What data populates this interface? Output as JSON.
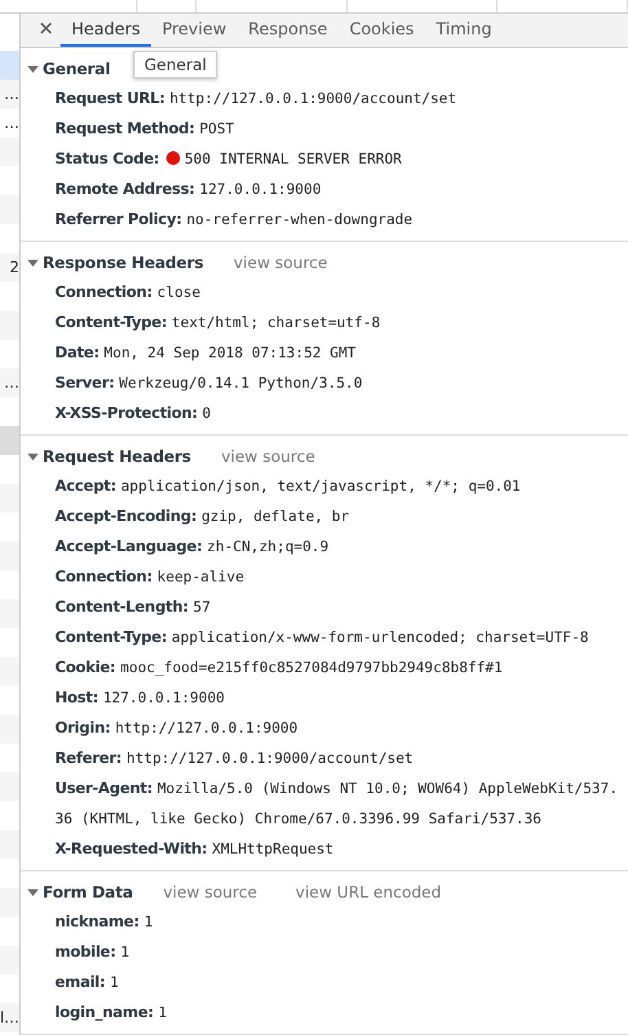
{
  "request_list": {
    "rows": [
      {
        "selected": true,
        "hovered": false
      },
      {
        "text": "…",
        "selected": false,
        "hovered": false
      },
      {
        "text": "…",
        "selected": false,
        "hovered": false
      },
      {
        "selected": false,
        "hovered": false
      },
      {
        "selected": false,
        "hovered": false
      },
      {
        "selected": false,
        "hovered": false
      },
      {
        "selected": false,
        "hovered": false
      },
      {
        "text": "2",
        "selected": false,
        "hovered": false
      },
      {
        "selected": false,
        "hovered": false
      },
      {
        "selected": false,
        "hovered": false
      },
      {
        "selected": false,
        "hovered": false
      },
      {
        "text": "…",
        "selected": false,
        "hovered": false
      },
      {
        "selected": false,
        "hovered": false
      },
      {
        "selected": false,
        "hovered": true
      },
      {
        "selected": false,
        "hovered": false
      },
      {
        "selected": false,
        "hovered": false
      },
      {
        "selected": false,
        "hovered": false
      },
      {
        "selected": false,
        "hovered": false
      },
      {
        "selected": false,
        "hovered": false
      },
      {
        "selected": false,
        "hovered": false
      },
      {
        "selected": false,
        "hovered": false
      },
      {
        "selected": false,
        "hovered": false
      },
      {
        "selected": false,
        "hovered": false
      },
      {
        "selected": false,
        "hovered": false
      },
      {
        "selected": false,
        "hovered": false
      },
      {
        "selected": false,
        "hovered": false
      },
      {
        "selected": false,
        "hovered": false
      },
      {
        "selected": false,
        "hovered": false
      },
      {
        "selected": false,
        "hovered": false
      },
      {
        "selected": false,
        "hovered": false
      },
      {
        "selected": false,
        "hovered": false
      },
      {
        "selected": false,
        "hovered": false
      },
      {
        "selected": false,
        "hovered": false
      },
      {
        "text": "l…",
        "selected": false,
        "hovered": false
      }
    ]
  },
  "tabs": [
    {
      "label": "Headers",
      "selected": true
    },
    {
      "label": "Preview",
      "selected": false
    },
    {
      "label": "Response",
      "selected": false
    },
    {
      "label": "Cookies",
      "selected": false
    },
    {
      "label": "Timing",
      "selected": false
    }
  ],
  "tooltip": "General",
  "sections": [
    {
      "title": "General",
      "expanded": true,
      "rows": [
        {
          "name": "Request URL:",
          "value": "http://127.0.0.1:9000/account/set"
        },
        {
          "name": "Request Method:",
          "value": "POST"
        },
        {
          "name": "Status Code:",
          "value": "500 INTERNAL SERVER ERROR",
          "color": "#e0120c"
        },
        {
          "name": "Remote Address:",
          "value": "127.0.0.1:9000"
        },
        {
          "name": "Referrer Policy:",
          "value": "no-referrer-when-downgrade"
        }
      ]
    },
    {
      "title": "Response Headers",
      "expanded": true,
      "links": [
        "view source"
      ],
      "rows": [
        {
          "name": "Connection:",
          "value": "close"
        },
        {
          "name": "Content-Type:",
          "value": "text/html; charset=utf-8"
        },
        {
          "name": "Date:",
          "value": "Mon, 24 Sep 2018 07:13:52 GMT"
        },
        {
          "name": "Server:",
          "value": "Werkzeug/0.14.1 Python/3.5.0"
        },
        {
          "name": "X-XSS-Protection:",
          "value": "0"
        }
      ]
    },
    {
      "title": "Request Headers",
      "expanded": true,
      "links": [
        "view source"
      ],
      "rows": [
        {
          "name": "Accept:",
          "value": "application/json, text/javascript, */*; q=0.01"
        },
        {
          "name": "Accept-Encoding:",
          "value": "gzip, deflate, br"
        },
        {
          "name": "Accept-Language:",
          "value": "zh-CN,zh;q=0.9"
        },
        {
          "name": "Connection:",
          "value": "keep-alive"
        },
        {
          "name": "Content-Length:",
          "value": "57"
        },
        {
          "name": "Content-Type:",
          "value": "application/x-www-form-urlencoded; charset=UTF-8"
        },
        {
          "name": "Cookie:",
          "value": "mooc_food=e215ff0c8527084d9797bb2949c8b8ff#1"
        },
        {
          "name": "Host:",
          "value": "127.0.0.1:9000"
        },
        {
          "name": "Origin:",
          "value": "http://127.0.0.1:9000"
        },
        {
          "name": "Referer:",
          "value": "http://127.0.0.1:9000/account/set"
        },
        {
          "name": "User-Agent:",
          "value": "Mozilla/5.0 (Windows NT 10.0; WOW64) AppleWebKit/537.36 (KHTML, like Gecko) Chrome/67.0.3396.99 Safari/537.36"
        },
        {
          "name": "X-Requested-With:",
          "value": "XMLHttpRequest"
        }
      ]
    },
    {
      "title": "Form Data",
      "expanded": true,
      "links": [
        "view source",
        "view URL encoded"
      ],
      "rows": [
        {
          "name": "nickname:",
          "value": "1"
        },
        {
          "name": "mobile:",
          "value": "1"
        },
        {
          "name": "email:",
          "value": "1"
        },
        {
          "name": "login_name:",
          "value": "1"
        }
      ]
    }
  ]
}
